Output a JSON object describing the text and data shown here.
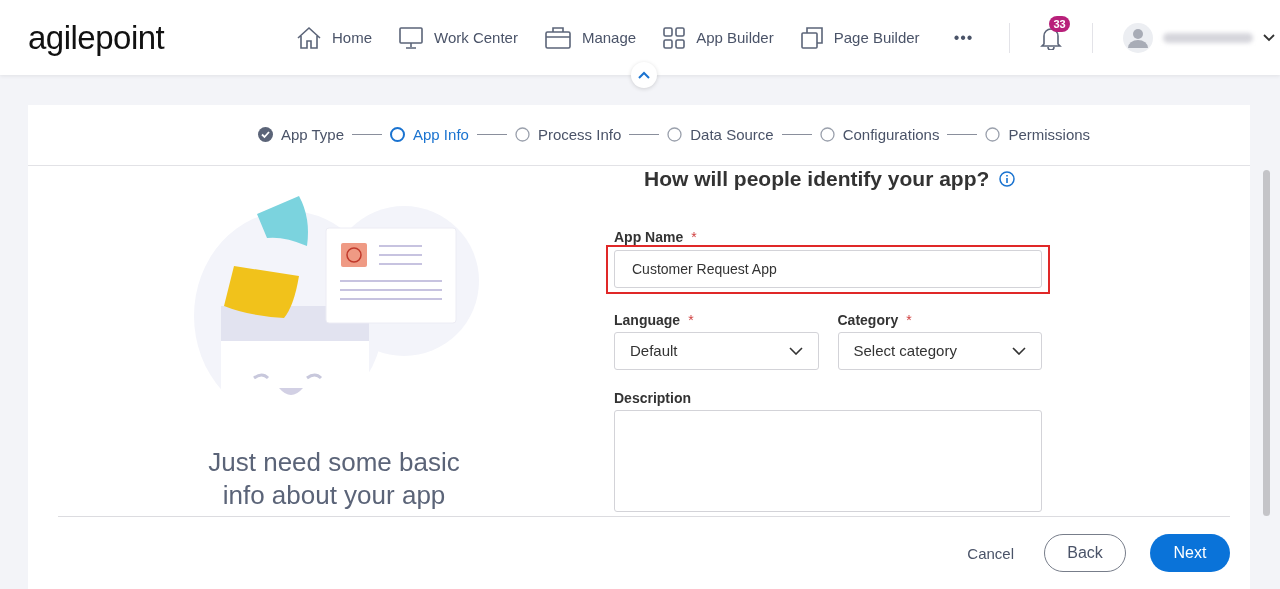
{
  "header": {
    "logo": "agilepoint",
    "nav": [
      {
        "label": "Home"
      },
      {
        "label": "Work Center"
      },
      {
        "label": "Manage"
      },
      {
        "label": "App Builder"
      },
      {
        "label": "Page Builder"
      }
    ],
    "more": "•••",
    "notifications": "33"
  },
  "steps": [
    {
      "label": "App Type",
      "completed": true,
      "selected": false
    },
    {
      "label": "App Info",
      "completed": false,
      "selected": true
    },
    {
      "label": "Process Info",
      "completed": false,
      "selected": false
    },
    {
      "label": "Data Source",
      "completed": false,
      "selected": false
    },
    {
      "label": "Configurations",
      "completed": false,
      "selected": false
    },
    {
      "label": "Permissions",
      "completed": false,
      "selected": false
    }
  ],
  "illustration": {
    "caption": "Just need some basic info about your app"
  },
  "form": {
    "title": "How will people identify your app?",
    "app_name": {
      "label": "App Name",
      "required": "*",
      "value": "Customer Request App",
      "highlighted": true
    },
    "language": {
      "label": "Language",
      "required": "*",
      "value": "Default"
    },
    "category": {
      "label": "Category",
      "required": "*",
      "placeholder": "Select category"
    },
    "description": {
      "label": "Description"
    }
  },
  "footer": {
    "cancel": "Cancel",
    "back": "Back",
    "next": "Next"
  }
}
